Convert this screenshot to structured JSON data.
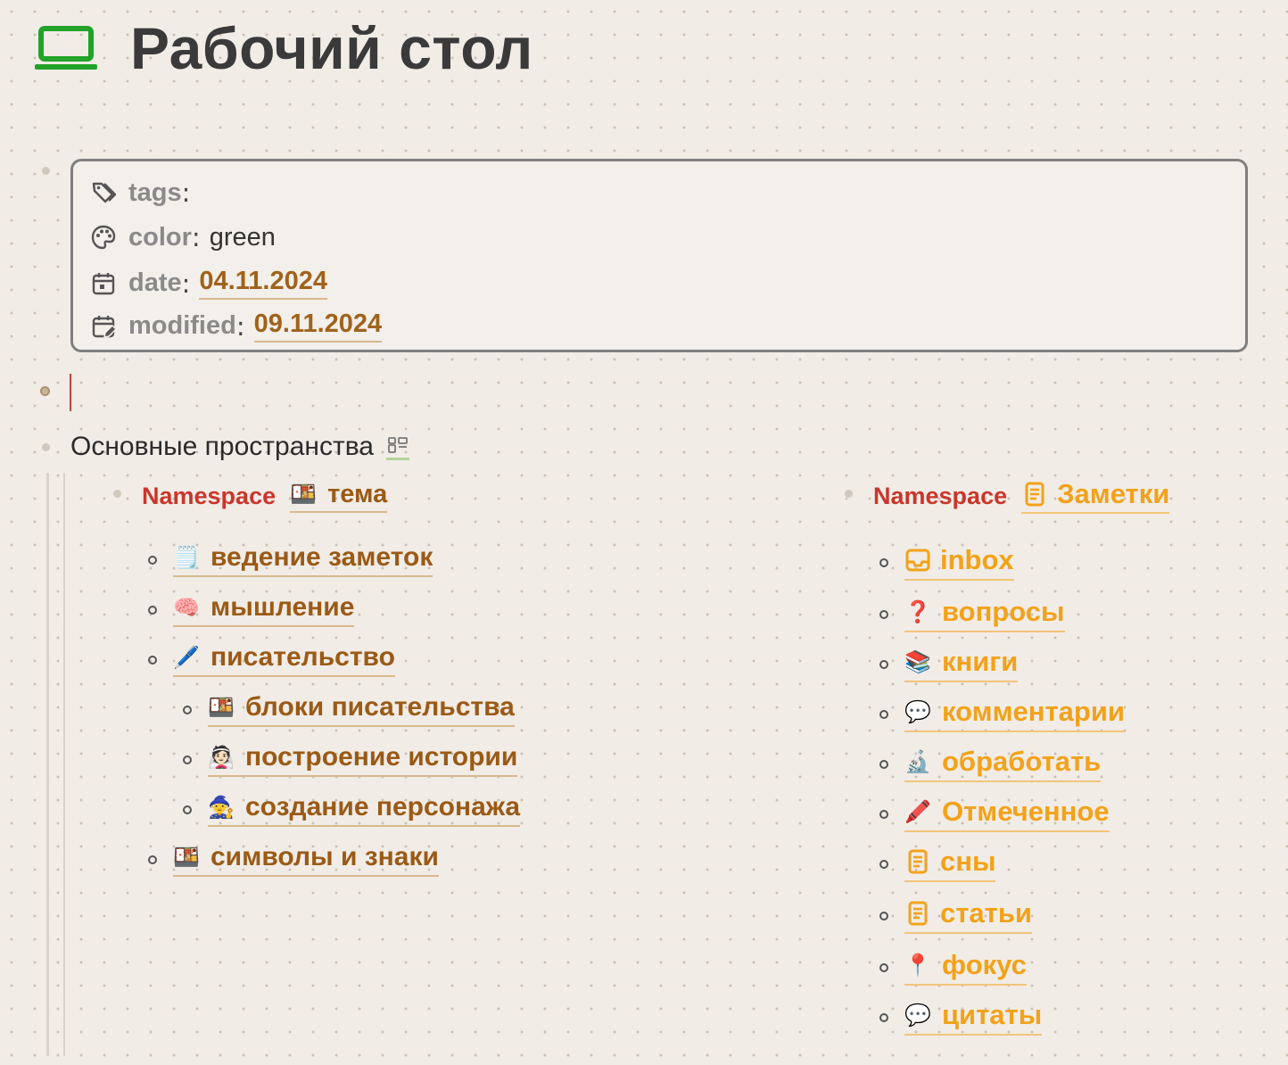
{
  "page": {
    "title": "Рабочий стол",
    "title_icon": "laptop-icon",
    "accent": "#22a22a"
  },
  "properties": {
    "tags": {
      "key": "tags",
      "value": "",
      "icon": "tags-icon"
    },
    "color": {
      "key": "color",
      "value": "green",
      "icon": "palette-icon"
    },
    "date": {
      "key": "date",
      "value": "04.11.2024",
      "icon": "calendar-icon"
    },
    "modified": {
      "key": "modified",
      "value": "09.11.2024",
      "icon": "calendar-edit-icon"
    }
  },
  "spaces": {
    "title": "Основные пространства",
    "left": {
      "ns_label": "Namespace",
      "ns_emoji": "🍱",
      "ns_name": "тема",
      "items": [
        {
          "emoji": "🗒️",
          "label": "ведение заметок"
        },
        {
          "emoji": "🧠",
          "label": "мышление"
        },
        {
          "emoji": "🖊️",
          "label": "писательство"
        },
        {
          "emoji": "🍱",
          "label": "блоки писательства"
        },
        {
          "emoji": "👰🏻",
          "label": "построение истории"
        },
        {
          "emoji": "🧙",
          "label": "создание персонажа"
        },
        {
          "emoji": "🍱",
          "label": "символы и знаки"
        }
      ]
    },
    "right": {
      "ns_label": "Namespace",
      "ns_icon": "document-icon",
      "ns_name": "Заметки",
      "items": [
        {
          "icon": "inbox-icon",
          "label": "inbox"
        },
        {
          "emoji": "❓",
          "label": "вопросы"
        },
        {
          "emoji": "📚",
          "label": "книги"
        },
        {
          "emoji": "💬",
          "label": "комментарии"
        },
        {
          "emoji": "🔬",
          "label": "обработать"
        },
        {
          "emoji": "🖍️",
          "label": "Отмеченное"
        },
        {
          "icon": "document-icon",
          "label": "сны"
        },
        {
          "icon": "document-icon",
          "label": "статьи"
        },
        {
          "emoji": "📍",
          "label": "фокус"
        },
        {
          "emoji": "💬",
          "label": "цитаты"
        }
      ]
    }
  }
}
